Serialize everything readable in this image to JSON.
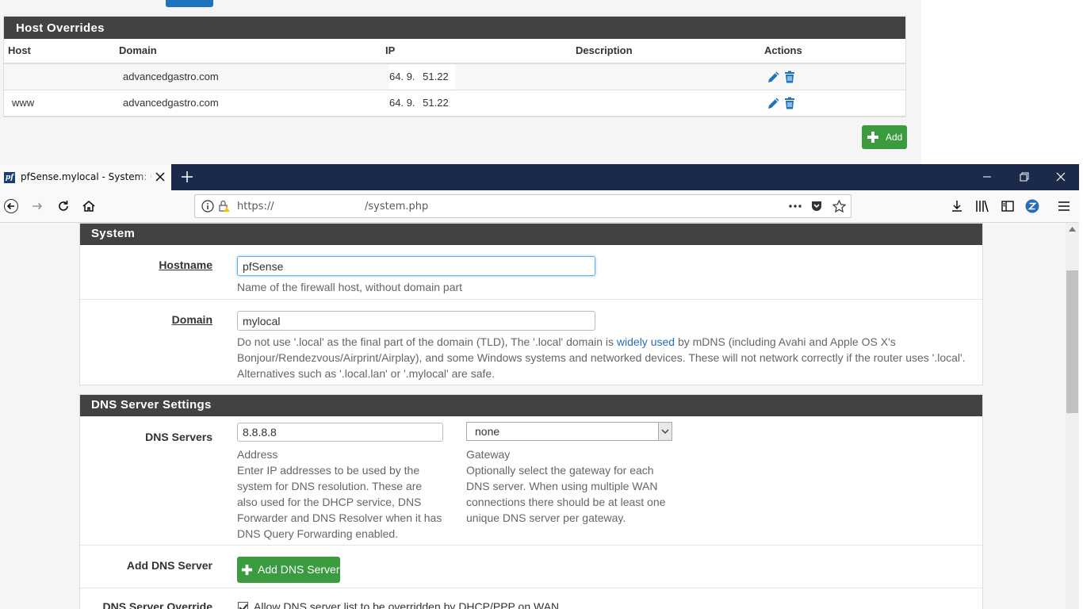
{
  "host_overrides": {
    "title": "Host Overrides",
    "columns": [
      "Host",
      "Domain",
      "IP",
      "Description",
      "Actions"
    ],
    "rows": [
      {
        "host": "",
        "domain": "advancedgastro.com",
        "ip_a": "64.",
        "ip_b": "9.",
        "ip_c": "51.22",
        "description": ""
      },
      {
        "host": "www",
        "domain": "advancedgastro.com",
        "ip_a": "64.",
        "ip_b": "9.",
        "ip_c": "51.22",
        "description": ""
      }
    ],
    "add_label": "Add"
  },
  "browser": {
    "tab_title": "pfSense.mylocal - System: General Setup",
    "url_scheme": "https://",
    "url_path": "/system.php"
  },
  "system": {
    "title": "System",
    "hostname": {
      "label": "Hostname",
      "value": "pfSense",
      "help": "Name of the firewall host, without domain part"
    },
    "domain": {
      "label": "Domain",
      "value": "mylocal",
      "help_pre": "Do not use '.local' as the final part of the domain (TLD), The '.local' domain is ",
      "help_link": "widely used",
      "help_post": " by mDNS (including Avahi and Apple OS X's Bonjour/Rendezvous/Airprint/Airplay), and some Windows systems and networked devices. These will not network correctly if the router uses '.local'. Alternatives such as '.local.lan' or '.mylocal' are safe."
    }
  },
  "dns": {
    "title": "DNS Server Settings",
    "servers_label": "DNS Servers",
    "server_value": "8.8.8.8",
    "address_label": "Address",
    "address_help": "Enter IP addresses to be used by the system for DNS resolution. These are also used for the DHCP service, DNS Forwarder and DNS Resolver when it has DNS Query Forwarding enabled.",
    "gateway_value": "none",
    "gateway_label": "Gateway",
    "gateway_help": "Optionally select the gateway for each DNS server. When using multiple WAN connections there should be at least one unique DNS server per gateway.",
    "add_label": "Add DNS Server",
    "add_button": "Add DNS Server",
    "override_label": "DNS Server Override",
    "override_text": "Allow DNS server list to be overridden by DHCP/PPP on WAN"
  },
  "colors": {
    "heading_bg": "#424242",
    "success": "#3b9b3f",
    "link": "#2a6db5",
    "tabbar": "#1b2a4a"
  },
  "icons": [
    "pencil-icon",
    "trash-icon",
    "plus-icon",
    "close-icon",
    "back-icon",
    "forward-icon",
    "reload-icon",
    "home-icon",
    "info-icon",
    "lock-warning-icon",
    "more-icon",
    "pocket-icon",
    "star-icon",
    "download-icon",
    "library-icon",
    "sidebar-icon",
    "zotero-icon",
    "menu-icon"
  ]
}
